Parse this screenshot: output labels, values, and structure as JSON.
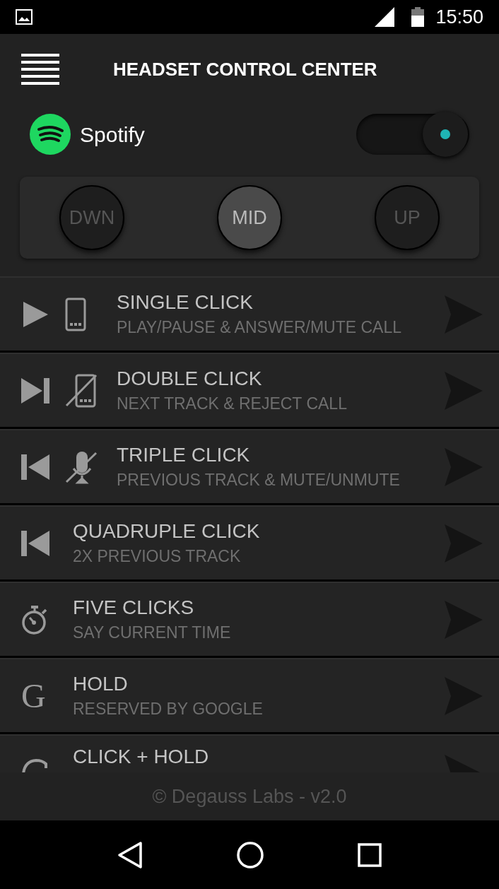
{
  "status_bar": {
    "time": "15:50"
  },
  "header": {
    "title": "HEADSET CONTROL CENTER"
  },
  "player": {
    "name": "Spotify",
    "on": true
  },
  "modes": [
    {
      "label": "DWN",
      "selected": false
    },
    {
      "label": "MID",
      "selected": true
    },
    {
      "label": "UP",
      "selected": false
    }
  ],
  "actions": [
    {
      "title": "SINGLE CLICK",
      "subtitle": "PLAY/PAUSE & ANSWER/MUTE CALL",
      "icons": [
        {
          "kind": "play"
        },
        {
          "kind": "phone"
        }
      ]
    },
    {
      "title": "DOUBLE CLICK",
      "subtitle": "NEXT TRACK & REJECT CALL",
      "icons": [
        {
          "kind": "next"
        },
        {
          "kind": "phone-off"
        }
      ]
    },
    {
      "title": "TRIPLE CLICK",
      "subtitle": "PREVIOUS TRACK & MUTE/UNMUTE",
      "icons": [
        {
          "kind": "prev"
        },
        {
          "kind": "mic-off"
        }
      ]
    },
    {
      "title": "QUADRUPLE CLICK",
      "subtitle": "2X PREVIOUS TRACK",
      "icons": [
        {
          "kind": "prev"
        }
      ]
    },
    {
      "title": "FIVE CLICKS",
      "subtitle": "SAY CURRENT TIME",
      "icons": [
        {
          "kind": "stopwatch"
        }
      ]
    },
    {
      "title": "HOLD",
      "subtitle": "RESERVED BY GOOGLE",
      "icons": [
        {
          "kind": "letter",
          "text": "G"
        }
      ]
    },
    {
      "title": "CLICK + HOLD",
      "icons": [
        {
          "kind": "partial-letter"
        }
      ]
    }
  ],
  "footer": {
    "text": "© Degauss Labs - v2.0"
  }
}
